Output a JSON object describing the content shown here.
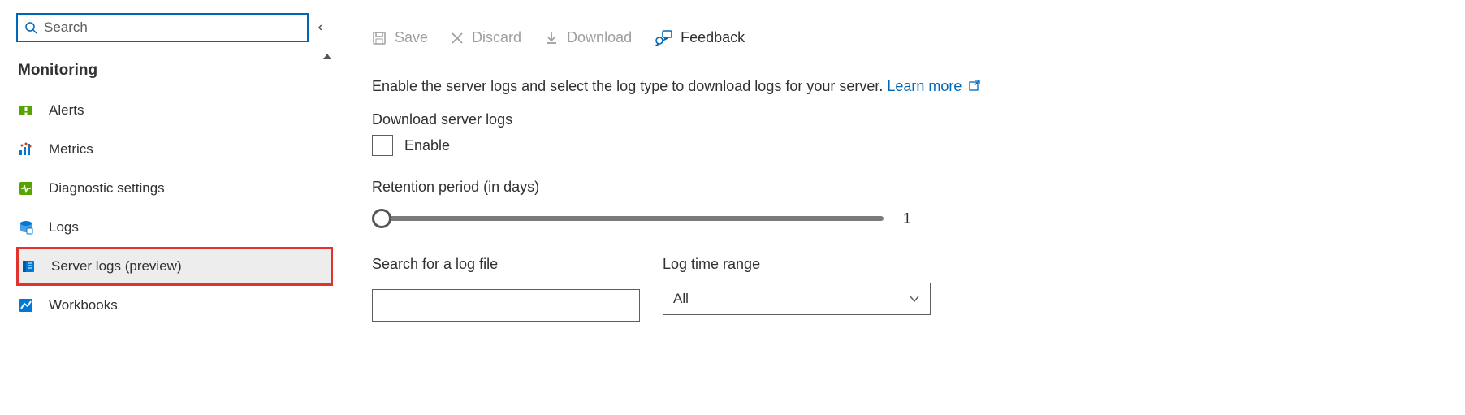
{
  "sidebar": {
    "search": {
      "placeholder": "Search"
    },
    "section": "Monitoring",
    "items": [
      {
        "label": "Alerts"
      },
      {
        "label": "Metrics"
      },
      {
        "label": "Diagnostic settings"
      },
      {
        "label": "Logs"
      },
      {
        "label": "Server logs (preview)"
      },
      {
        "label": "Workbooks"
      }
    ]
  },
  "toolbar": {
    "save": "Save",
    "discard": "Discard",
    "download": "Download",
    "feedback": "Feedback"
  },
  "main": {
    "description": "Enable the server logs and select the log type to download logs for your server.",
    "learn_more": "Learn more",
    "download_label": "Download server logs",
    "enable_label": "Enable",
    "retention_label": "Retention period (in days)",
    "retention_value": "1",
    "search_label": "Search for a log file",
    "timerange_label": "Log time range",
    "timerange_value": "All"
  }
}
